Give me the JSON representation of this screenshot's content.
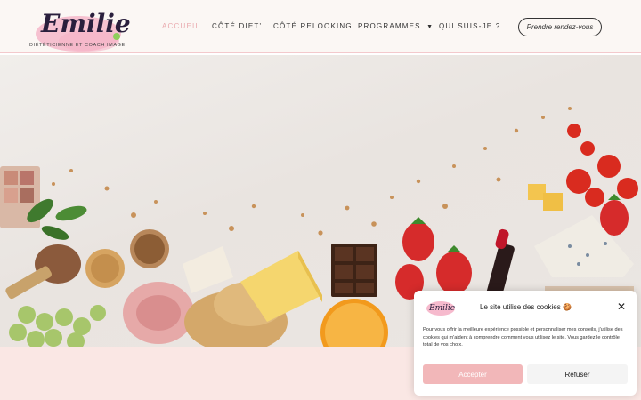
{
  "header": {
    "logo_name": "Emilie",
    "logo_tagline": "DIÉTÉTICIENNE ET COACH IMAGE",
    "nav": [
      {
        "label": "ACCUEIL",
        "active": true
      },
      {
        "label": "CÔTÉ DIET'",
        "active": false
      },
      {
        "label": "CÔTÉ RELOOKING",
        "active": false
      },
      {
        "label": "PROGRAMMES",
        "active": false
      },
      {
        "label": "QUI SUIS-JE ?",
        "active": false
      }
    ],
    "cta_label": "Prendre rendez-vous"
  },
  "cookie": {
    "title": "Le site utilise des cookies 🍪",
    "body": "Pour vous offrir la meilleure expérience possible et personnaliser mes conseils, j'utilise des cookies qui m'aident à comprendre comment vous utilisez le site. Vous gardez le contrôle total de vos choix.",
    "accept_label": "Accepter",
    "refuse_label": "Refuser"
  },
  "colors": {
    "accent_pink": "#f2b7b9",
    "nav_active": "#e9a9ad",
    "header_bg": "#fbf7f4",
    "footer_bg": "#fae7e4"
  }
}
